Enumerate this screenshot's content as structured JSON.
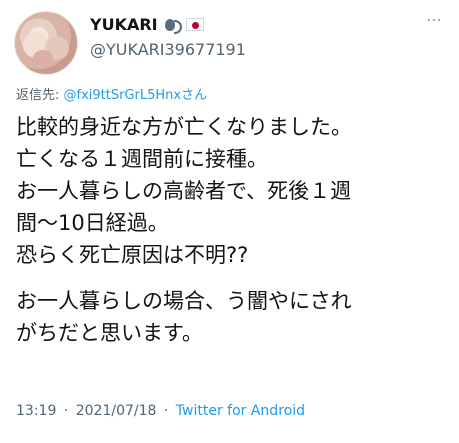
{
  "author": {
    "display_name": "YUKARI",
    "handle": "@YUKARI39677191",
    "badges": [
      "speaking-head-icon",
      "japan-flag-icon"
    ]
  },
  "more_icon": "⋯",
  "reply": {
    "prefix": "返信先:",
    "mention": "@fxi9ttSrGrL5Hnxさん"
  },
  "body": {
    "lines": [
      "比較的身近な方が亡くなりました。",
      "亡くなる１週間前に接種。",
      "お一人暮らしの高齢者で、死後１週",
      "間〜10日経過。",
      "恐らく死亡原因は不明??",
      "お一人暮らしの場合、う闇やにされ",
      "がちだと思います。"
    ]
  },
  "meta": {
    "time": "13:19",
    "separator": "·",
    "date": "2021/07/18",
    "source": "Twitter for Android"
  }
}
